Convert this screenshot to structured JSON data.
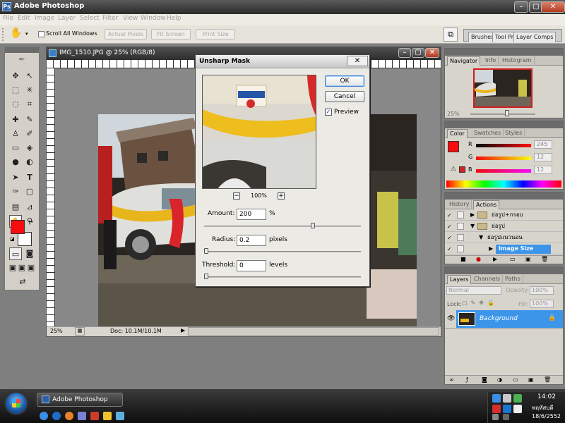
{
  "app": {
    "title": "Adobe Photoshop"
  },
  "menu": [
    "File",
    "Edit",
    "Image",
    "Layer",
    "Select",
    "Filter",
    "View",
    "Window",
    "Help"
  ],
  "options": {
    "scroll_all_windows": "Scroll All Windows",
    "actual_pixels": "Actual Pixels",
    "fit_screen": "Fit Screen",
    "print_size": "Print Size",
    "tabs": [
      "Brushes",
      "Tool Pr",
      "Layer Comps"
    ]
  },
  "document": {
    "title": "IMG_1510.JPG @ 25% (RGB/8)",
    "zoom": "25%",
    "doc_size": "Doc: 10.1M/10.1M"
  },
  "dialog": {
    "title": "Unsharp Mask",
    "ok": "OK",
    "cancel": "Cancel",
    "preview_label": "Preview",
    "preview_checked": true,
    "preview_zoom": "100%",
    "amount_label": "Amount:",
    "amount_value": "200",
    "amount_unit": "%",
    "amount_slider": 0.7,
    "radius_label": "Radius:",
    "radius_value": "0.2",
    "radius_unit": "pixels",
    "radius_slider": 0.0,
    "threshold_label": "Threshold:",
    "threshold_value": "0",
    "threshold_unit": "levels",
    "threshold_slider": 0.0
  },
  "navigator": {
    "tabs": [
      "Navigator",
      "Info",
      "Histogram"
    ],
    "zoom": "25%"
  },
  "color": {
    "tabs": [
      "Color",
      "Swatches",
      "Styles"
    ],
    "r_label": "R",
    "r_value": "245",
    "g_label": "G",
    "g_value": "12",
    "b_label": "B",
    "b_value": "12",
    "fg_color": "#f50c0c"
  },
  "actions": {
    "tabs": [
      "History",
      "Actions"
    ],
    "items": [
      "ย่อรูป+กรอบ",
      "ย่อรูป",
      "ย่อรูปแนวนอน",
      "Image Size"
    ]
  },
  "layers": {
    "tabs": [
      "Layers",
      "Channels",
      "Paths"
    ],
    "blend_mode": "Normal",
    "opacity_label": "Opacity:",
    "opacity_value": "100%",
    "lock_label": "Lock:",
    "fill_label": "Fill:",
    "fill_value": "100%",
    "layer_name": "Background"
  },
  "taskbar": {
    "task_label": "Adobe Photoshop",
    "time": "14:02",
    "day": "พฤหัสบดี",
    "date": "18/6/2552"
  },
  "colors": {
    "accent_blue": "#3d95ea",
    "foreground": "#f50c0c"
  }
}
